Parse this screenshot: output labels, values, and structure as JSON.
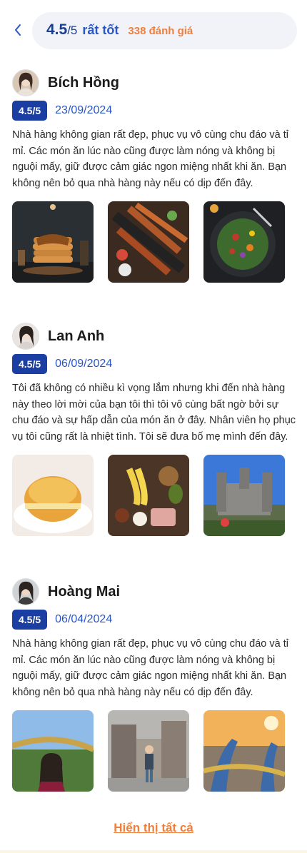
{
  "header": {
    "score": "4.5",
    "max": "/5",
    "label": "rất tốt",
    "count": "338 đánh giá"
  },
  "reviews": [
    {
      "name": "Bích Hồng",
      "rating": "4.5/5",
      "date": "23/09/2024",
      "text": "Nhà hàng không gian rất đẹp, phục vụ vô cùng chu đáo và tỉ mỉ. Các món ăn lúc nào cũng được làm nóng và không bị nguội mấy, giữ được cảm giác ngon miệng nhất khi ăn. Bạn không nên bỏ qua nhà hàng này nếu có dịp đến đây."
    },
    {
      "name": "Lan Anh",
      "rating": "4.5/5",
      "date": "06/09/2024",
      "text": "Tôi đã không có nhiều kì vọng lắm nhưng khi đến nhà hàng này theo lời mời của bạn tôi thì tôi vô cùng bất ngờ bởi sự chu đáo và sự hấp dẫn của món ăn ở đây. Nhân viên họ phục vụ tôi cũng rất là nhiệt tình. Tôi sẽ đưa bố mẹ mình đến đây."
    },
    {
      "name": "Hoàng Mai",
      "rating": "4.5/5",
      "date": "06/04/2024",
      "text": "Nhà hàng không gian rất đẹp, phục vụ vô cùng chu đáo và tỉ mỉ. Các món ăn lúc nào cũng được làm nóng và không bị nguội mấy, giữ được cảm giác ngon miệng nhất khi ăn. Bạn không nên bỏ qua nhà hàng này nếu có dịp đến đây."
    }
  ],
  "show_all": "Hiển thị tất cả",
  "colors": {
    "primary": "#1b3ea3",
    "accent": "#ef7f3d",
    "pill_bg": "#f1f3f8"
  },
  "icons": {
    "back": "chevron-left-icon"
  }
}
